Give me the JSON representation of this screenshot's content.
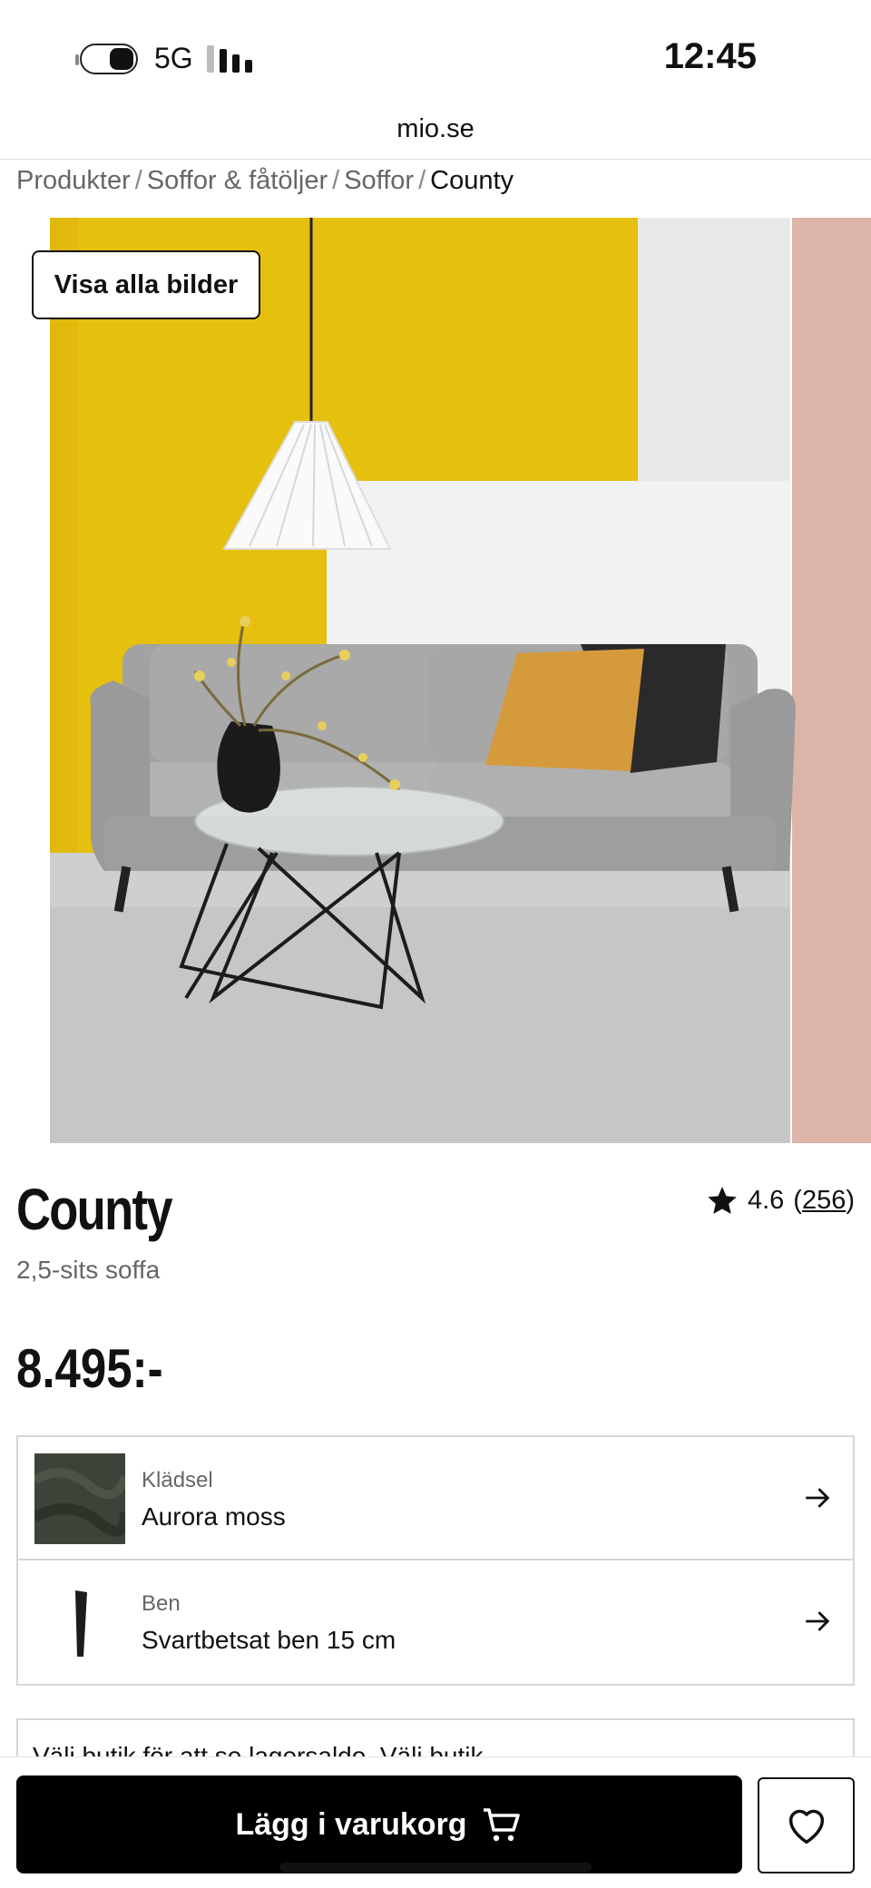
{
  "status_bar": {
    "network": "5G",
    "time": "12:45"
  },
  "browser": {
    "url": "mio.se"
  },
  "breadcrumb": [
    {
      "label": "Produkter"
    },
    {
      "label": "Soffor & fåtöljer"
    },
    {
      "label": "Soffor"
    },
    {
      "label": "County"
    }
  ],
  "breadcrumb_separator": "/",
  "gallery": {
    "show_all_label": "Visa alla bilder"
  },
  "product": {
    "name": "County",
    "type": "2,5-sits soffa",
    "price": "8.495:-",
    "rating": "4.6",
    "review_count": "256"
  },
  "options": [
    {
      "label": "Klädsel",
      "value": "Aurora moss",
      "icon": "fabric-swatch"
    },
    {
      "label": "Ben",
      "value": "Svartbetsat ben 15 cm",
      "icon": "sofa-leg"
    }
  ],
  "store": {
    "text": "Välj butik för att se lagersaldo. Välj butik"
  },
  "actions": {
    "add_to_cart": "Lägg i varukorg",
    "favorite_icon": "heart-icon"
  },
  "colors": {
    "accent": "#000000",
    "wall_yellow": "#e8c20f",
    "sofa_grey": "#9b9b9b"
  }
}
